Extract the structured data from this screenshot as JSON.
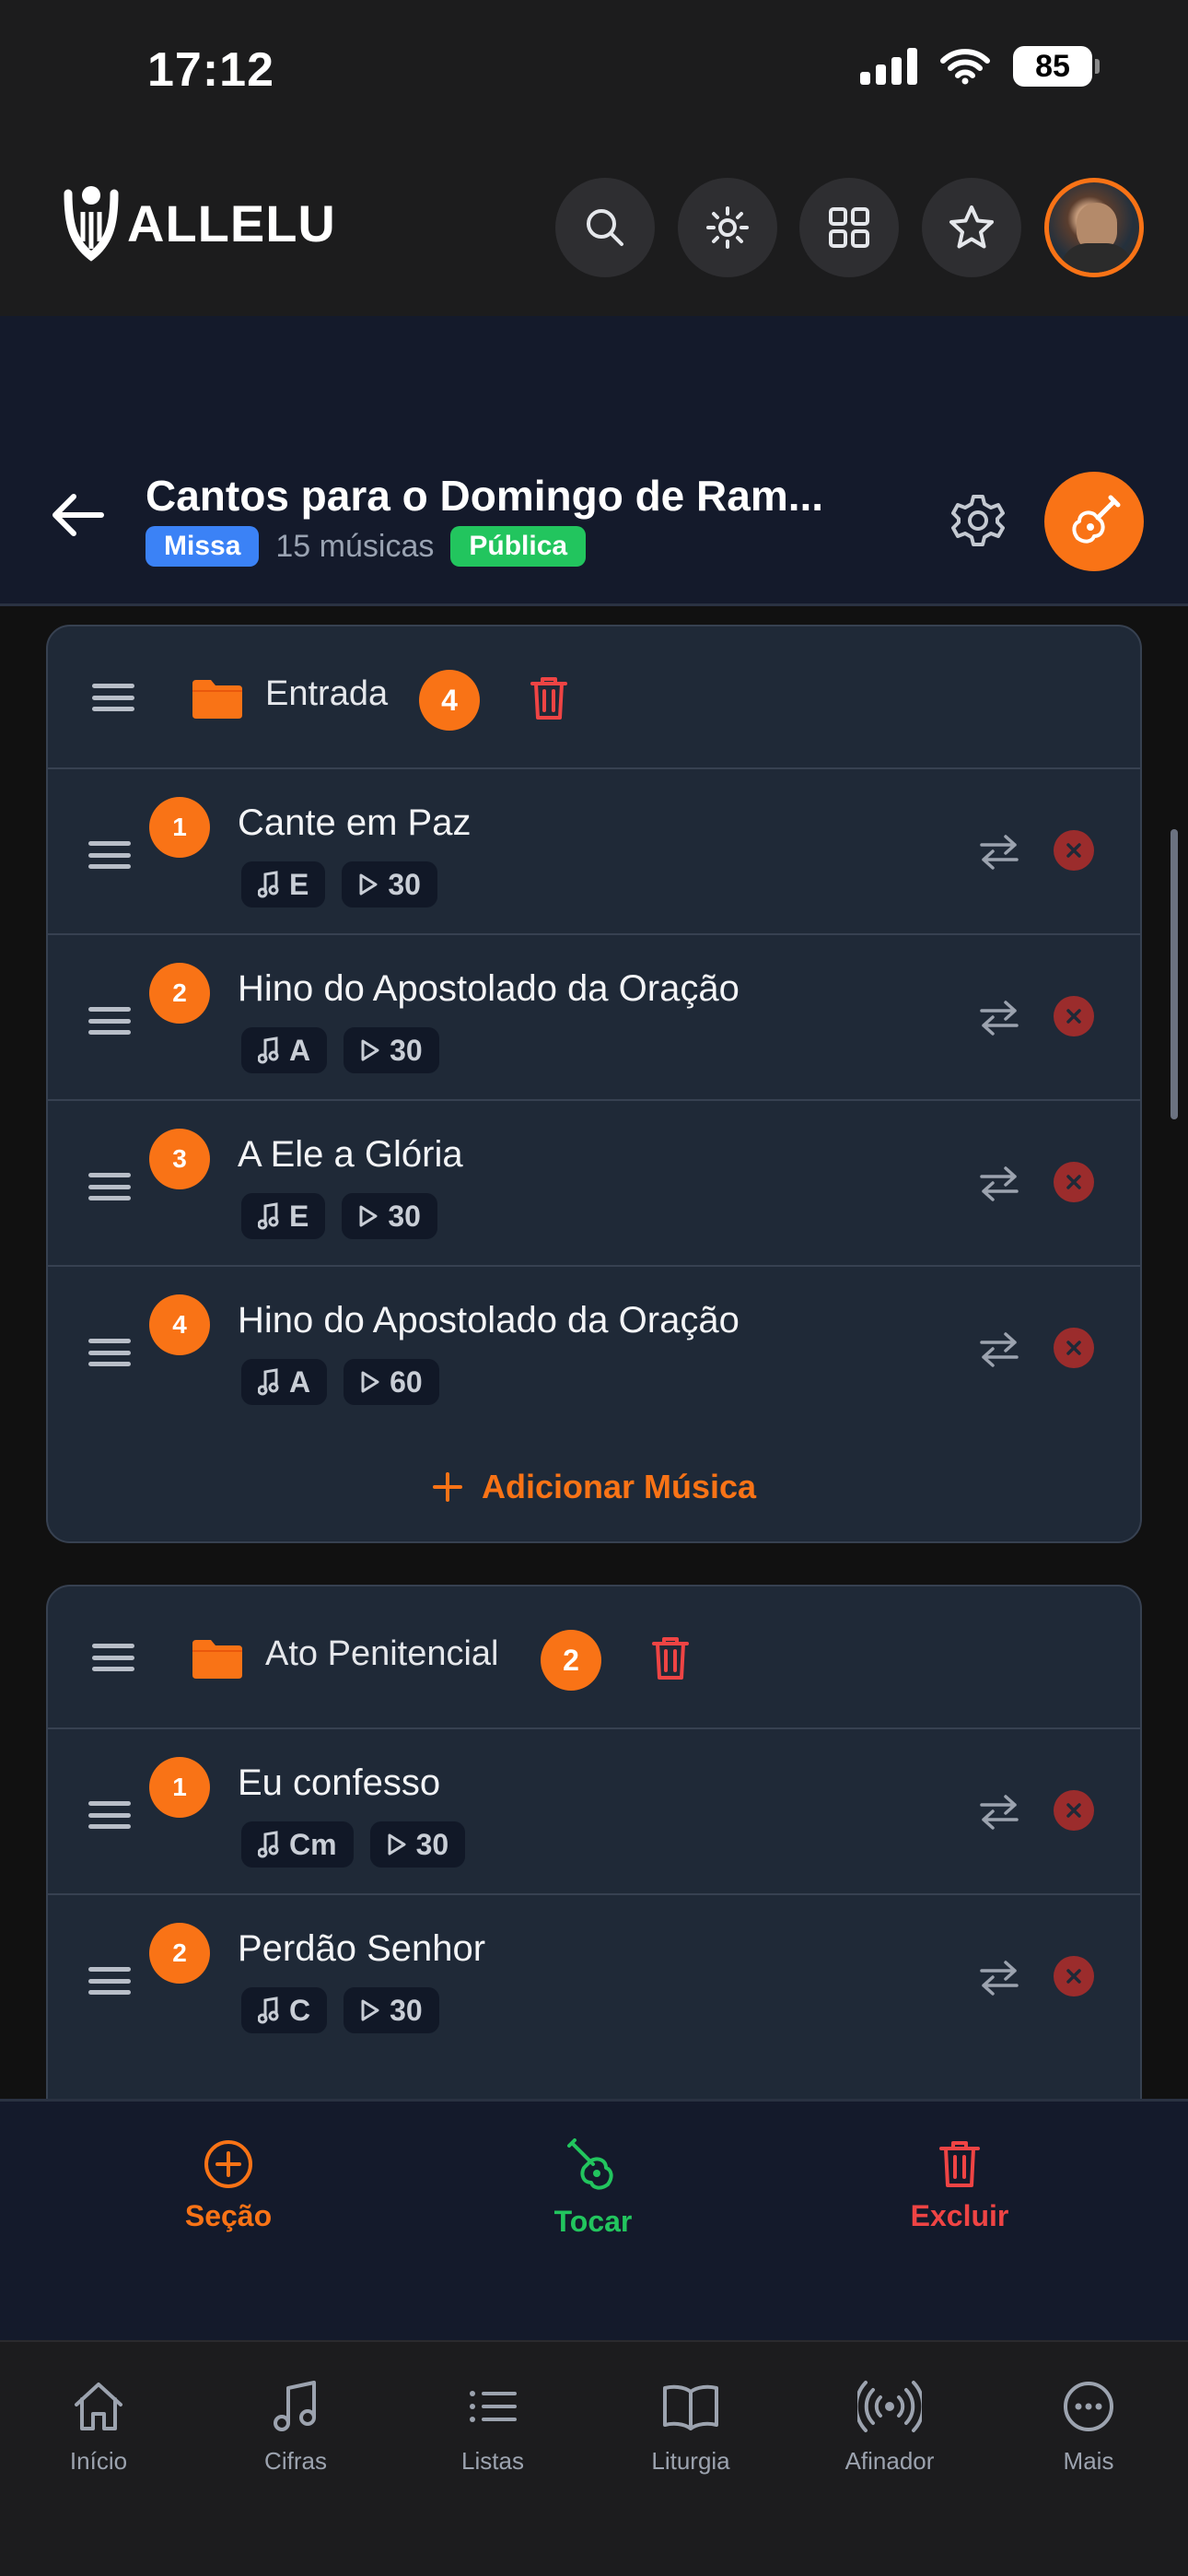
{
  "status": {
    "time": "17:12",
    "battery": "85"
  },
  "header": {
    "logo": "ALLELU"
  },
  "list": {
    "title": "Cantos para o Domingo de Ram...",
    "tag_type": "Missa",
    "song_count": "15 músicas",
    "visibility": "Pública"
  },
  "sections": [
    {
      "title": "Entrada",
      "count": "4",
      "songs": [
        {
          "num": "1",
          "title": "Cante em Paz",
          "key": "E",
          "duration": "30"
        },
        {
          "num": "2",
          "title": "Hino do Apostolado da Oração",
          "key": "A",
          "duration": "30"
        },
        {
          "num": "3",
          "title": "A Ele a Glória",
          "key": "E",
          "duration": "30"
        },
        {
          "num": "4",
          "title": "Hino do Apostolado da Oração",
          "key": "A",
          "duration": "60"
        }
      ],
      "add_label": "Adicionar Música"
    },
    {
      "title": "Ato Penitencial",
      "count": "2",
      "songs": [
        {
          "num": "1",
          "title": "Eu confesso",
          "key": "Cm",
          "duration": "30"
        },
        {
          "num": "2",
          "title": "Perdão Senhor",
          "key": "C",
          "duration": "30"
        }
      ]
    }
  ],
  "actions": {
    "section": "Seção",
    "play": "Tocar",
    "delete": "Excluir"
  },
  "tabs": [
    "Início",
    "Cifras",
    "Listas",
    "Liturgia",
    "Afinador",
    "Mais"
  ],
  "colors": {
    "accent": "#f97316",
    "play": "#22c55e",
    "danger": "#ef4444"
  }
}
